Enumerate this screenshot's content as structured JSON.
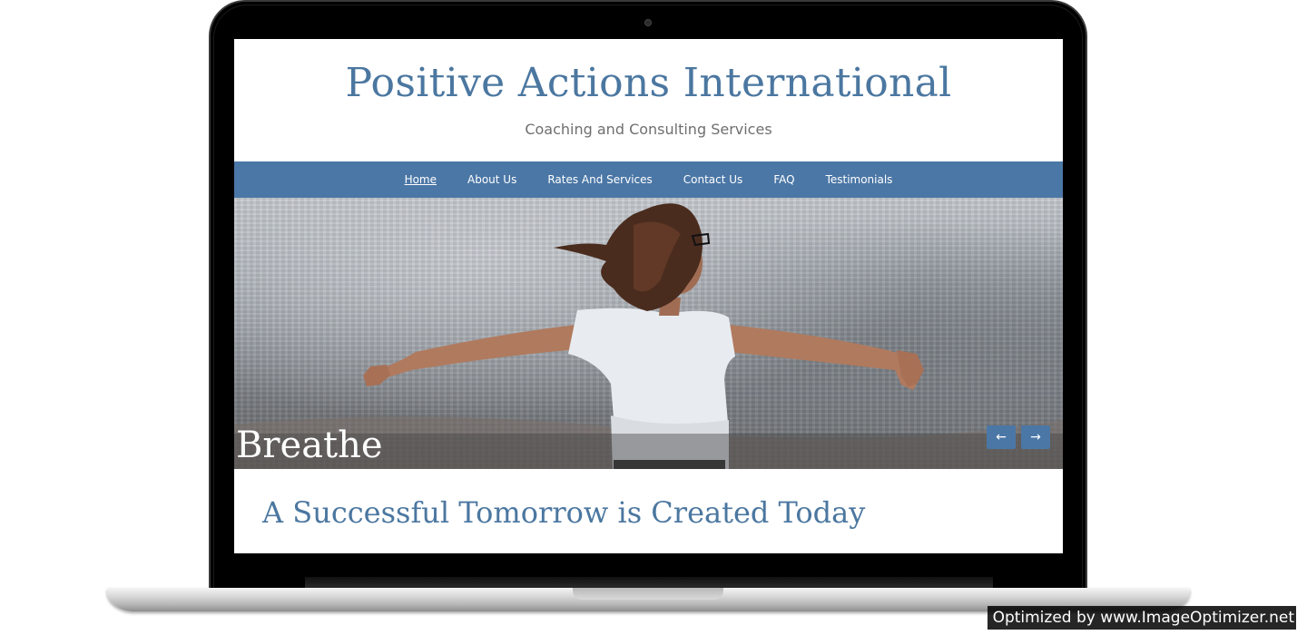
{
  "site": {
    "title": "Positive Actions International",
    "tagline": "Coaching and Consulting Services"
  },
  "nav": {
    "items": [
      {
        "label": "Home",
        "active": true
      },
      {
        "label": "About Us",
        "active": false
      },
      {
        "label": "Rates And Services",
        "active": false
      },
      {
        "label": "Contact Us",
        "active": false
      },
      {
        "label": "FAQ",
        "active": false
      },
      {
        "label": "Testimonials",
        "active": false
      }
    ]
  },
  "hero": {
    "caption": "Breathe",
    "prev_icon": "←",
    "next_icon": "→"
  },
  "main": {
    "headline": "A Successful Tomorrow is Created Today"
  },
  "watermark": {
    "text": "Optimized by www.ImageOptimizer.net"
  },
  "colors": {
    "brand_blue": "#4b77a6",
    "title_blue": "#4b77a0",
    "tagline_gray": "#6f6f6f"
  }
}
